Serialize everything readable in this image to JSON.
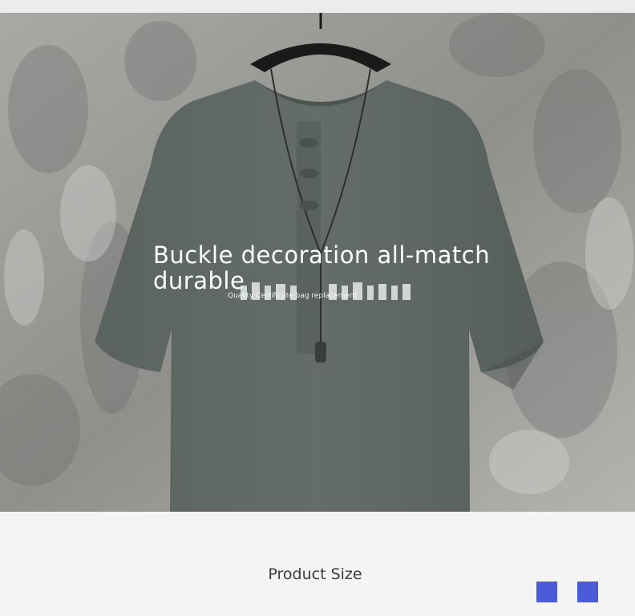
{
  "overlay": {
    "title": "Buckle decoration all-match\ndurable",
    "caption": "Quality Certificate bag replacement"
  },
  "section": {
    "heading": "Product Size"
  },
  "colors": {
    "accent_square": "#4b5bd8",
    "shirt": "#5e6663",
    "wall": "#9a9a98"
  },
  "icons": [
    "square-icon",
    "square-icon"
  ]
}
